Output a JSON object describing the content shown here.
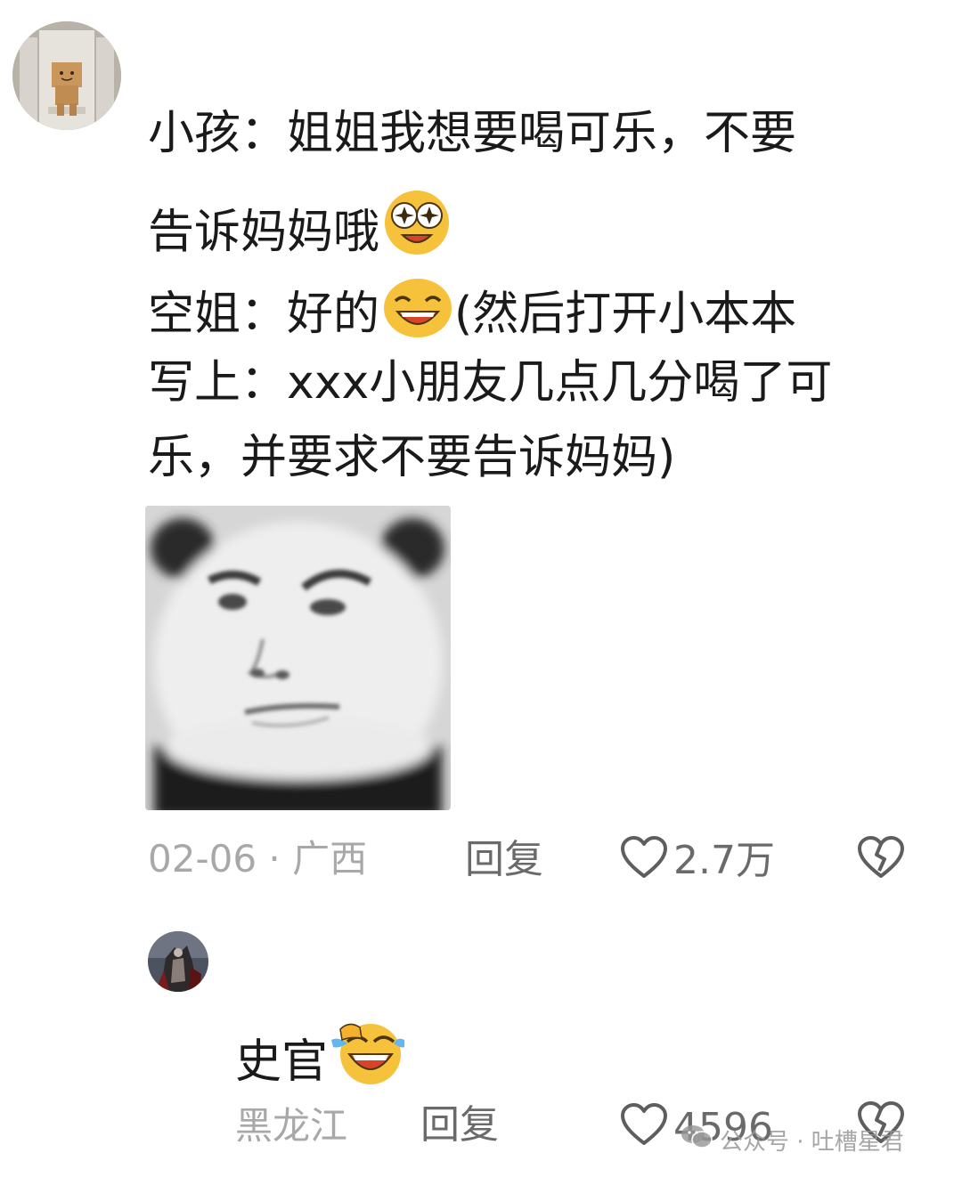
{
  "comment1": {
    "lines": [
      "小孩：姐姐我想要喝可乐，不要",
      "告诉妈妈哦",
      "空姐：好的",
      "(然后打开小本本",
      "写上：xxx小朋友几点几分喝了可",
      "乐，并要求不要告诉妈妈)"
    ],
    "date": "02-06",
    "location": "广西",
    "reply_label": "回复",
    "likes": "2.7万"
  },
  "reply1": {
    "text": "史官",
    "location": "黑龙江",
    "reply_label": "回复",
    "likes": "4596"
  },
  "watermark": {
    "text": "公众号 · 吐槽星君"
  },
  "colors": {
    "meta_gray": "#a8a8a8",
    "action_gray": "#6a6a6a",
    "text": "#1a1a1a"
  },
  "icons": [
    "heart-icon",
    "broken-heart-icon",
    "star-eyes-emoji",
    "grin-emoji",
    "laugh-cry-emoji",
    "wechat-logo-icon"
  ]
}
